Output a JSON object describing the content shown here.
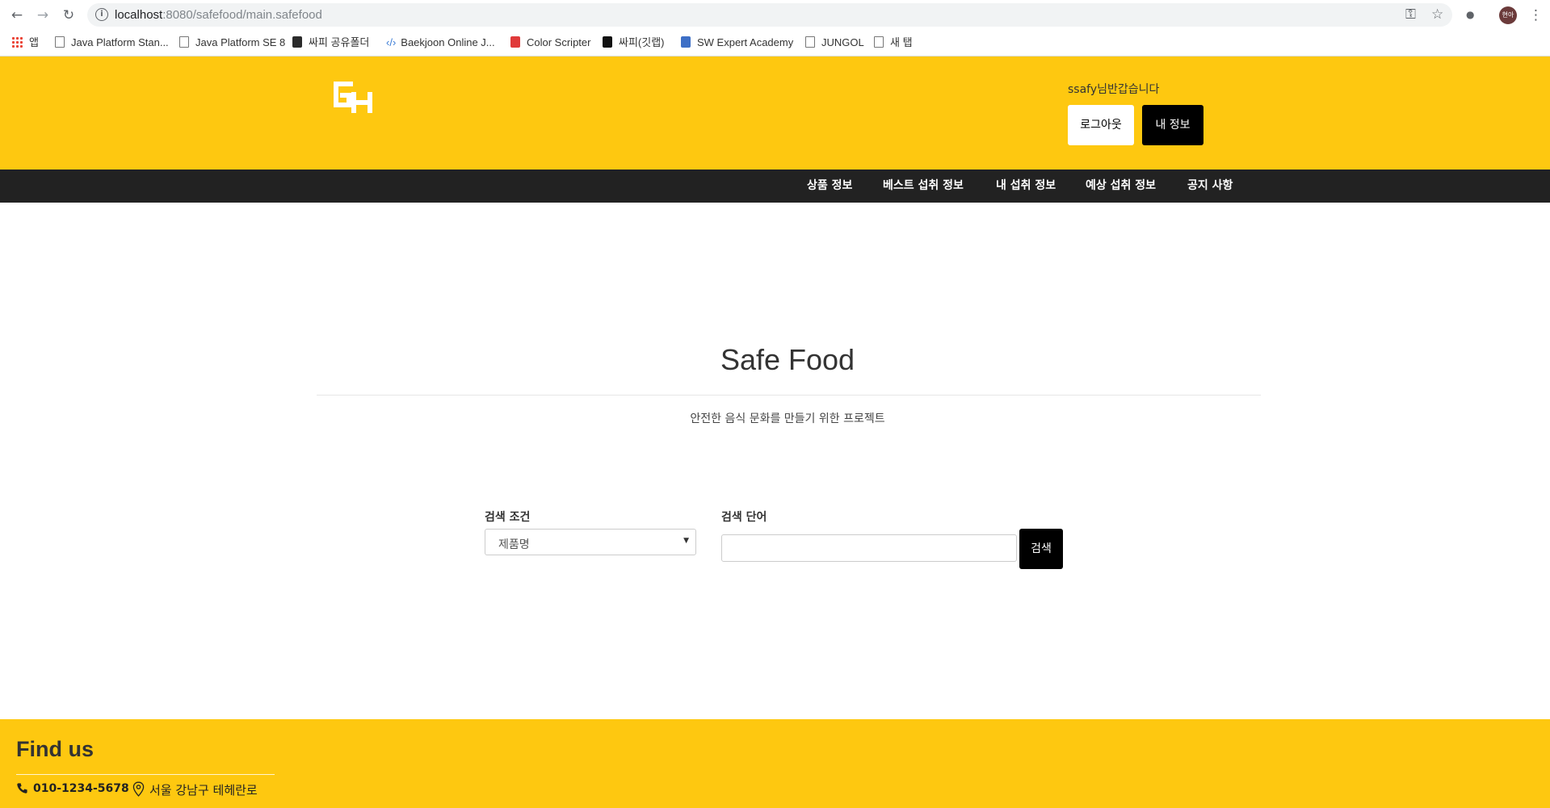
{
  "browser": {
    "url_host": "localhost",
    "url_rest": ":8080/safefood/main.safefood",
    "bookmarks": [
      "앱",
      "Java Platform Stan...",
      "Java Platform SE 8",
      "싸피 공유폴더",
      "Baekjoon Online J...",
      "Color Scripter",
      "싸피(깃랩)",
      "SW Expert Academy",
      "JUNGOL",
      "새 탭"
    ],
    "avatar_text": "현아"
  },
  "header": {
    "greeting": "ssafy님반갑습니다",
    "logout_label": "로그아웃",
    "myinfo_label": "내 정보"
  },
  "nav": [
    "상품 정보",
    "베스트 섭취 정보",
    "내 섭취 정보",
    "예상 섭취 정보",
    "공지 사항"
  ],
  "hero": {
    "title": "Safe Food",
    "subtitle": "안전한 음식 문화를 만들기 위한 프로젝트"
  },
  "search": {
    "condition_label": "검색 조건",
    "condition_value": "제품명",
    "term_label": "검색 단어",
    "term_value": "",
    "button_label": "검색"
  },
  "footer": {
    "title": "Find us",
    "phone": "010-1234-5678",
    "address": "서울 강남구 테헤란로"
  },
  "colors": {
    "brand_yellow": "#fec810",
    "nav_dark": "#222222"
  }
}
